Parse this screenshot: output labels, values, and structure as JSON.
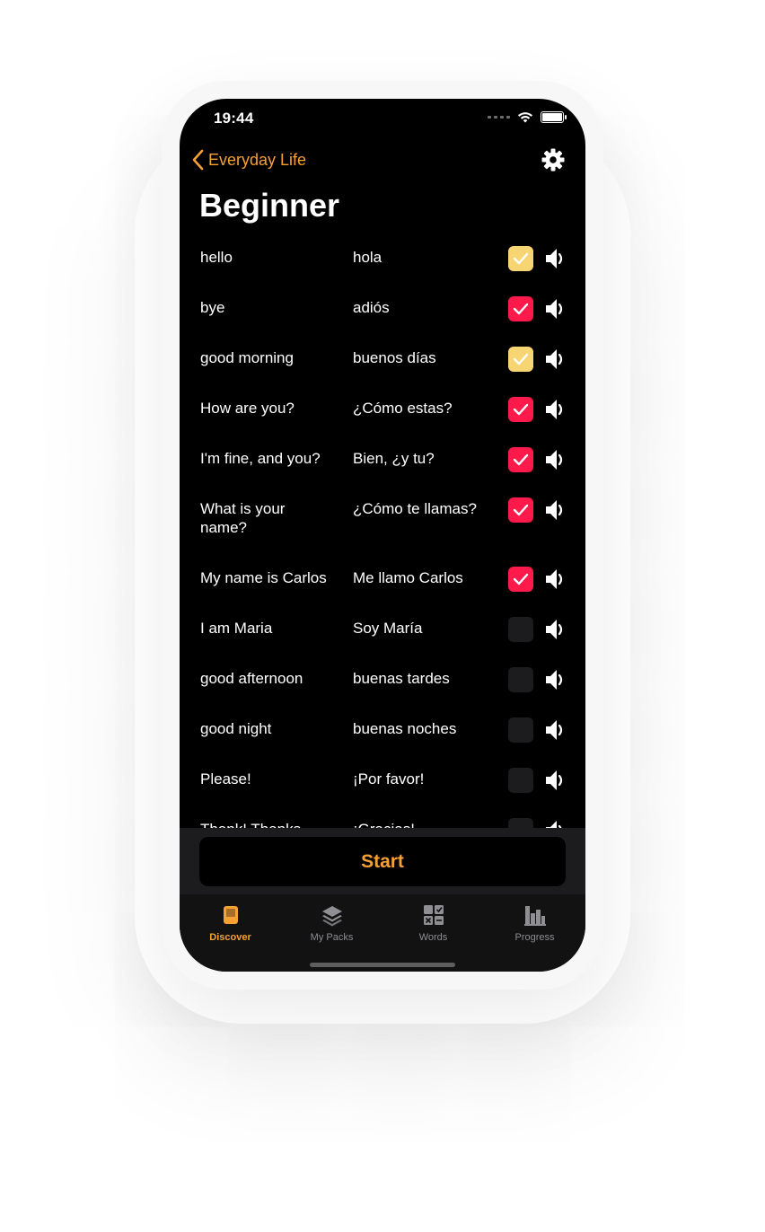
{
  "status_bar": {
    "time": "19:44"
  },
  "nav": {
    "back_label": "Everyday Life"
  },
  "page": {
    "title": "Beginner"
  },
  "phrases": [
    {
      "en": "hello",
      "es": "hola",
      "state": "yellow"
    },
    {
      "en": "bye",
      "es": "adiós",
      "state": "red"
    },
    {
      "en": "good morning",
      "es": "buenos días",
      "state": "yellow"
    },
    {
      "en": "How are you?",
      "es": "¿Cómo estas?",
      "state": "red"
    },
    {
      "en": "I'm fine, and you?",
      "es": "Bien, ¿y tu?",
      "state": "red"
    },
    {
      "en": "What is your name?",
      "es": "¿Cómo te llamas?",
      "state": "red"
    },
    {
      "en": "My name is Carlos",
      "es": "Me llamo Carlos",
      "state": "red"
    },
    {
      "en": "I am Maria",
      "es": "Soy María",
      "state": "empty"
    },
    {
      "en": "good afternoon",
      "es": "buenas tardes",
      "state": "empty"
    },
    {
      "en": "good night",
      "es": "buenas noches",
      "state": "empty"
    },
    {
      "en": "Please!",
      "es": "¡Por favor!",
      "state": "empty"
    },
    {
      "en": "Thank! Thanks",
      "es": "¡Gracias!",
      "state": "empty"
    }
  ],
  "footer": {
    "start_label": "Start"
  },
  "tabs": [
    {
      "label": "Discover",
      "icon": "book-icon",
      "active": true
    },
    {
      "label": "My Packs",
      "icon": "layers-icon",
      "active": false
    },
    {
      "label": "Words",
      "icon": "grid-icon",
      "active": false
    },
    {
      "label": "Progress",
      "icon": "bar-chart-icon",
      "active": false
    }
  ],
  "colors": {
    "accent": "#f7a033",
    "learned": "#ff1a4b",
    "review": "#f7d573",
    "empty": "#1c1c1e"
  }
}
